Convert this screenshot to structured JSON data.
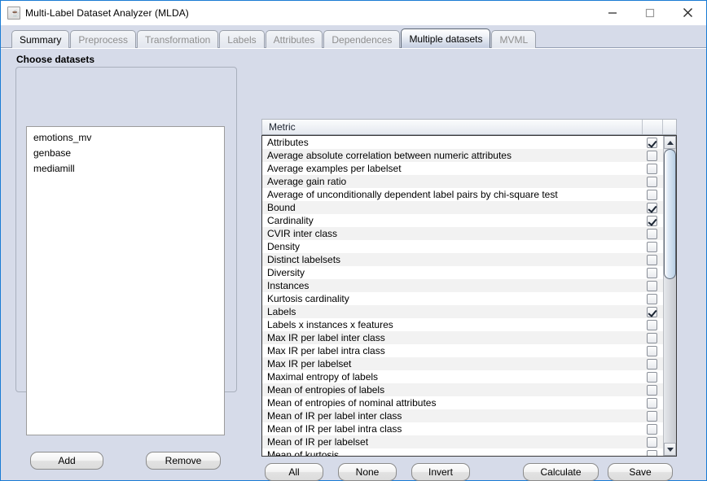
{
  "window": {
    "title": "Multi-Label Dataset Analyzer (MLDA)",
    "icon": "java-cup-icon",
    "controls": {
      "minimize": "minimize-icon",
      "maximize": "maximize-icon",
      "close": "close-icon"
    },
    "accent_border": "#1a7bd4",
    "background": "#d6dbe9"
  },
  "tabs": [
    {
      "label": "Summary",
      "state": "enabled"
    },
    {
      "label": "Preprocess",
      "state": "disabled"
    },
    {
      "label": "Transformation",
      "state": "disabled"
    },
    {
      "label": "Labels",
      "state": "disabled"
    },
    {
      "label": "Attributes",
      "state": "disabled"
    },
    {
      "label": "Dependences",
      "state": "disabled"
    },
    {
      "label": "Multiple datasets",
      "state": "selected"
    },
    {
      "label": "MVML",
      "state": "disabled"
    }
  ],
  "left_panel": {
    "group_title": "Choose datasets",
    "datasets": [
      "emotions_mv",
      "genbase",
      "mediamill"
    ],
    "add_label": "Add",
    "remove_label": "Remove"
  },
  "right_panel": {
    "column_header": "Metric",
    "buttons": {
      "all": "All",
      "none": "None",
      "invert": "Invert",
      "calculate": "Calculate",
      "save": "Save"
    },
    "scrollbar": {
      "up_arrow": "scroll-up-icon",
      "down_arrow": "scroll-down-icon",
      "thumb_position": "top"
    },
    "metrics": [
      {
        "name": "Attributes",
        "checked": true
      },
      {
        "name": "Average absolute correlation between numeric attributes",
        "checked": false
      },
      {
        "name": "Average examples per labelset",
        "checked": false
      },
      {
        "name": "Average gain ratio",
        "checked": false
      },
      {
        "name": "Average of unconditionally dependent label pairs by chi-square test",
        "checked": false
      },
      {
        "name": "Bound",
        "checked": true
      },
      {
        "name": "Cardinality",
        "checked": true
      },
      {
        "name": "CVIR inter class",
        "checked": false
      },
      {
        "name": "Density",
        "checked": false
      },
      {
        "name": "Distinct labelsets",
        "checked": false
      },
      {
        "name": "Diversity",
        "checked": false
      },
      {
        "name": "Instances",
        "checked": false
      },
      {
        "name": "Kurtosis cardinality",
        "checked": false
      },
      {
        "name": "Labels",
        "checked": true
      },
      {
        "name": "Labels x instances x features",
        "checked": false
      },
      {
        "name": "Max IR per label inter class",
        "checked": false
      },
      {
        "name": "Max IR per label intra class",
        "checked": false
      },
      {
        "name": "Max IR per labelset",
        "checked": false
      },
      {
        "name": "Maximal entropy of labels",
        "checked": false
      },
      {
        "name": "Mean of entropies of labels",
        "checked": false
      },
      {
        "name": "Mean of entropies of nominal attributes",
        "checked": false
      },
      {
        "name": "Mean of IR per label inter class",
        "checked": false
      },
      {
        "name": "Mean of IR per label intra class",
        "checked": false
      },
      {
        "name": "Mean of IR per labelset",
        "checked": false
      },
      {
        "name": "Mean of kurtosis",
        "checked": false
      }
    ]
  }
}
